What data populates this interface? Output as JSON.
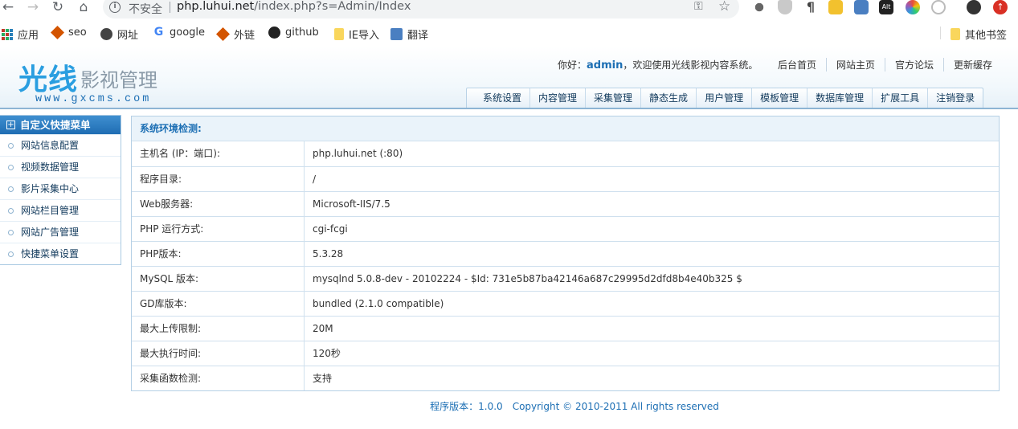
{
  "browser": {
    "nav": {
      "back": "←",
      "forward": "→",
      "reload": "↻",
      "home": "⌂"
    },
    "insecure_label": "不安全",
    "url_host": "php.luhui.net",
    "url_path": "/index.php?s=Admin/Index",
    "bookmarks": [
      {
        "label": "应用",
        "icon": "apps-grid-icon"
      },
      {
        "label": "seo",
        "icon": "diamond-icon"
      },
      {
        "label": "网址",
        "icon": "globe-icon"
      },
      {
        "label": "google",
        "icon": "google-icon"
      },
      {
        "label": "外链",
        "icon": "diamond-icon"
      },
      {
        "label": "github",
        "icon": "github-icon"
      },
      {
        "label": "IE导入",
        "icon": "folder-icon"
      },
      {
        "label": "翻译",
        "icon": "translate-icon"
      }
    ],
    "other_bookmarks": "其他书签"
  },
  "header": {
    "logo_main": "光线",
    "logo_sub": "影视管理",
    "logo_url": "www.gxcms.com",
    "greeting_prefix": "你好：",
    "username": "admin",
    "greeting_suffix": "，欢迎使用光线影视内容系统。",
    "top_links": [
      "后台首页",
      "网站主页",
      "官方论坛",
      "更新缓存"
    ],
    "nav": [
      "系统设置",
      "内容管理",
      "采集管理",
      "静态生成",
      "用户管理",
      "模板管理",
      "数据库管理",
      "扩展工具",
      "注销登录"
    ]
  },
  "sidebar": {
    "title": "自定义快捷菜单",
    "items": [
      "网站信息配置",
      "视频数据管理",
      "影片采集中心",
      "网站栏目管理",
      "网站广告管理",
      "快捷菜单设置"
    ]
  },
  "env": {
    "title": "系统环境检测:",
    "rows": [
      {
        "key": "主机名 (IP：端口):",
        "value": "php.luhui.net (:80)"
      },
      {
        "key": "程序目录:",
        "value": "/"
      },
      {
        "key": "Web服务器:",
        "value": "Microsoft-IIS/7.5"
      },
      {
        "key": "PHP 运行方式:",
        "value": "cgi-fcgi"
      },
      {
        "key": "PHP版本:",
        "value": "5.3.28"
      },
      {
        "key": "MySQL 版本:",
        "value": "mysqlnd 5.0.8-dev - 20102224 - $Id: 731e5b87ba42146a687c29995d2dfd8b4e40b325 $"
      },
      {
        "key": "GD库版本:",
        "value": "bundled (2.1.0 compatible)"
      },
      {
        "key": "最大上传限制:",
        "value": "20M"
      },
      {
        "key": "最大执行时间:",
        "value": "120秒"
      },
      {
        "key": "采集函数检测:",
        "value": "支持"
      }
    ]
  },
  "footer": {
    "version": "程序版本：1.0.0",
    "copyright": "Copyright © 2010-2011 All rights reserved"
  }
}
